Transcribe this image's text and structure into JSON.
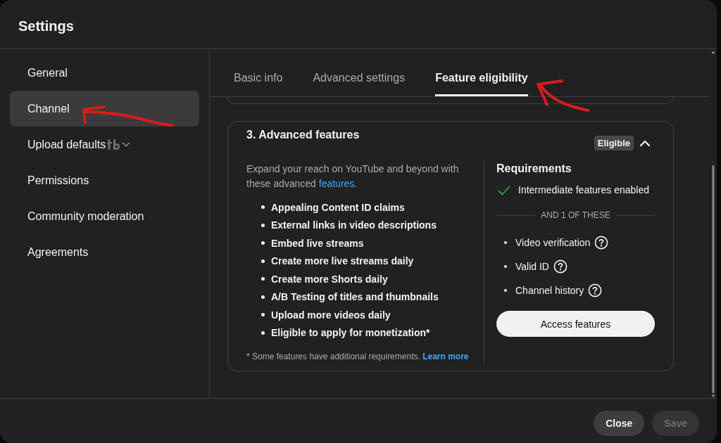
{
  "window": {
    "title": "Settings"
  },
  "sidebar": {
    "items": [
      {
        "label": "General",
        "kind": "page",
        "selected": false
      },
      {
        "label": "Channel",
        "kind": "page",
        "selected": true
      },
      {
        "label": "Upload defaults",
        "kind": "group",
        "selected": false,
        "expanded": false
      },
      {
        "label": "Permissions",
        "kind": "page",
        "selected": false
      },
      {
        "label": "Community moderation",
        "kind": "page",
        "selected": false
      },
      {
        "label": "Agreements",
        "kind": "page",
        "selected": false
      }
    ]
  },
  "tabs": [
    {
      "label": "Basic info",
      "selected": false
    },
    {
      "label": "Advanced settings",
      "selected": false
    },
    {
      "label": "Feature eligibility",
      "selected": true
    }
  ],
  "section": {
    "title": "3. Advanced features",
    "badge": "Eligible",
    "expanded": true,
    "description": {
      "text": "Expand your reach on YouTube and beyond with these advanced",
      "link": "features",
      "end": "."
    },
    "features": [
      "Appealing Content ID claims",
      "External links in video descriptions",
      "Embed live streams",
      "Create more live streams daily",
      "Create more Shorts daily",
      "A/B Testing of titles and thumbnails",
      "Upload more videos daily",
      "Eligible to apply for monetization*"
    ],
    "footnote": {
      "text": "* Some features have additional requirements.",
      "link": "Learn more"
    },
    "requirements": {
      "title": "Requirements",
      "required": [
        {
          "label": "Intermediate features enabled",
          "checked": true
        }
      ],
      "separator": "AND 1 OF THESE",
      "options": [
        {
          "label": "Video verification"
        },
        {
          "label": "Valid ID"
        },
        {
          "label": "Channel history"
        }
      ],
      "button": "Access features"
    }
  },
  "footer": {
    "buttons": [
      {
        "label": "Close",
        "disabled": false
      },
      {
        "label": "Save",
        "disabled": true
      }
    ]
  }
}
